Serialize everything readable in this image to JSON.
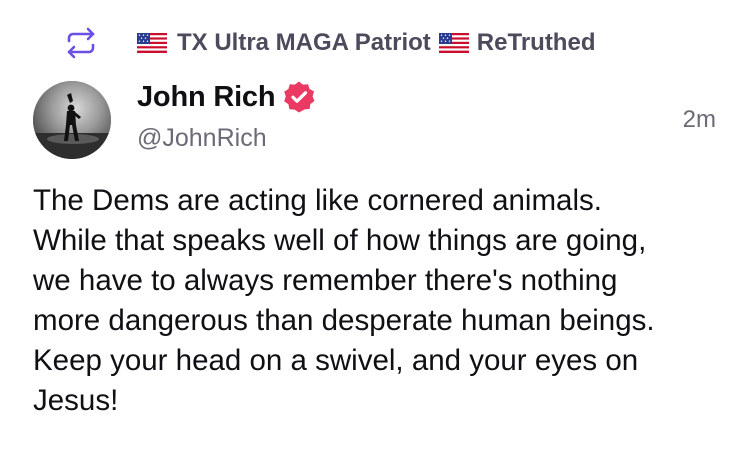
{
  "retruth": {
    "icon": "repost-arrows-icon",
    "flag_icon": "us-flag-icon",
    "account_name": "TX Ultra MAGA Patriot",
    "action": "ReTruthed",
    "icon_color": "#6b4fe6"
  },
  "author": {
    "display_name": "John Rich",
    "handle": "@JohnRich",
    "verified_icon": "verified-badge-icon",
    "verified_color": "#ea3a63"
  },
  "timestamp": "2m",
  "post": {
    "lines": [
      "The Dems are acting like cornered animals.",
      "While that speaks well of how things are going,",
      "we have to always remember there's nothing",
      "more dangerous than desperate human beings.",
      "Keep your head on a swivel, and your eyes on",
      "Jesus!"
    ]
  }
}
